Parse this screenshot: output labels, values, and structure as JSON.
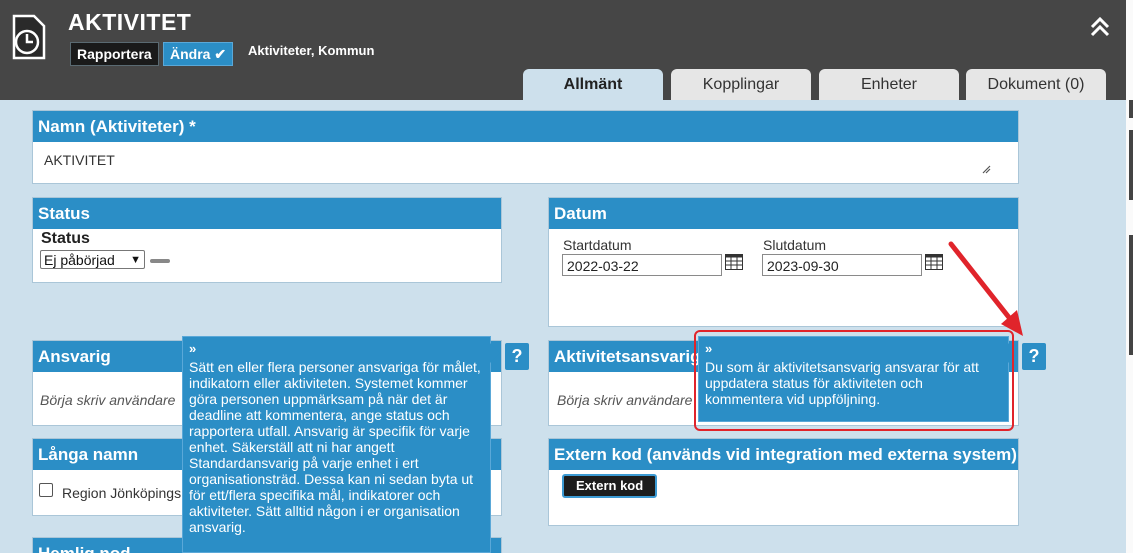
{
  "header": {
    "title": "AKTIVITET",
    "rapportera_label": "Rapportera",
    "andra_label": "Ändra",
    "breadcrumb": "Aktiviteter, Kommun"
  },
  "tabs": [
    {
      "label": "Allmänt",
      "active": true
    },
    {
      "label": "Kopplingar",
      "active": false
    },
    {
      "label": "Enheter",
      "active": false
    },
    {
      "label": "Dokument (0)",
      "active": false
    }
  ],
  "namn": {
    "header": "Namn (Aktiviteter) *",
    "value": "AKTIVITET"
  },
  "status": {
    "header": "Status",
    "label": "Status",
    "selected": "Ej påbörjad"
  },
  "datum": {
    "header": "Datum",
    "start_label": "Startdatum",
    "start_value": "2022-03-22",
    "end_label": "Slutdatum",
    "end_value": "2023-09-30"
  },
  "ansvarig": {
    "header": "Ansvarig",
    "placeholder": "Börja skriv användare",
    "help": "?",
    "tooltip_mark": "»",
    "tooltip": "Sätt en eller flera personer ansvariga för målet, indikatorn eller aktiviteten. Systemet kommer göra personen uppmärksam på när det är deadline att kommentera, ange status och rapportera utfall. Ansvarig är specifik för varje enhet. Säkerställ att ni har angett Standardansvarig på varje enhet i ert organisationsträd. Dessa kan ni sedan byta ut för ett/flera specifika mål, indikatorer och aktiviteter. Sätt alltid någon i er organisation ansvarig."
  },
  "aktivitetsansvarig": {
    "header": "Aktivitetsansvarig",
    "placeholder": "Börja skriv användare",
    "help": "?",
    "tooltip_mark": "»",
    "tooltip": "Du som är aktivitetsansvarig ansvarar för att uppdatera status för aktiviteten och kommentera vid uppföljning."
  },
  "langa_namn": {
    "header": "Långa namn",
    "checkbox_label": "Region Jönköpings län"
  },
  "extern_kod": {
    "header": "Extern kod (används vid integration med externa system)",
    "button": "Extern kod"
  },
  "hemlig_nod": {
    "header": "Hemlig nod"
  },
  "colors": {
    "header_bg": "#464646",
    "accent": "#2b8ec6",
    "page_bg": "#cde0ec",
    "highlight": "#e0242b"
  }
}
